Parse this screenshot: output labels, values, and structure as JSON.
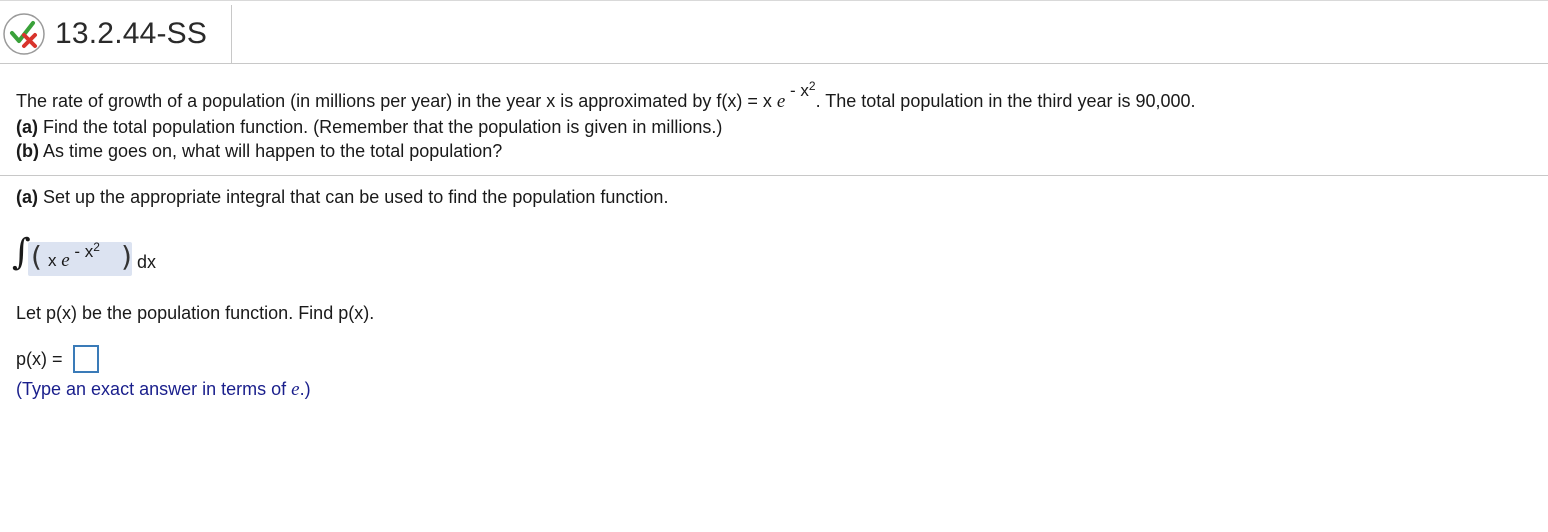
{
  "header": {
    "problem_id": "13.2.44-SS",
    "status_icon": "partially-correct-icon"
  },
  "question": {
    "line1_before": "The rate of growth of a population (in millions per year) in the year x is approximated by f(x) = x ",
    "line1_e": "e",
    "line1_exp": " - x",
    "line1_exp_power": "2",
    "line1_after": ". The total population in the third year is 90,000.",
    "part_a_label": "(a)",
    "part_a_text": " Find the total population function. (Remember that the population is given in millions.)",
    "part_b_label": "(b)",
    "part_b_text": " As time goes on, what will happen to the total population?"
  },
  "part_a": {
    "label": "(a)",
    "text": " Set up the appropriate integral that can be used to find the population function.",
    "integral_sign": "∫",
    "integrand_x": "x ",
    "integrand_e": "e",
    "integrand_exp": " - x",
    "integrand_exp_power": "2",
    "differential": "dx",
    "let_text": "Let p(x) be the population function. Find p(x).",
    "answer_label": "p(x) =",
    "answer_value": "",
    "hint_before": "(Type an exact answer in terms of ",
    "hint_e": "e",
    "hint_after": ".)"
  }
}
